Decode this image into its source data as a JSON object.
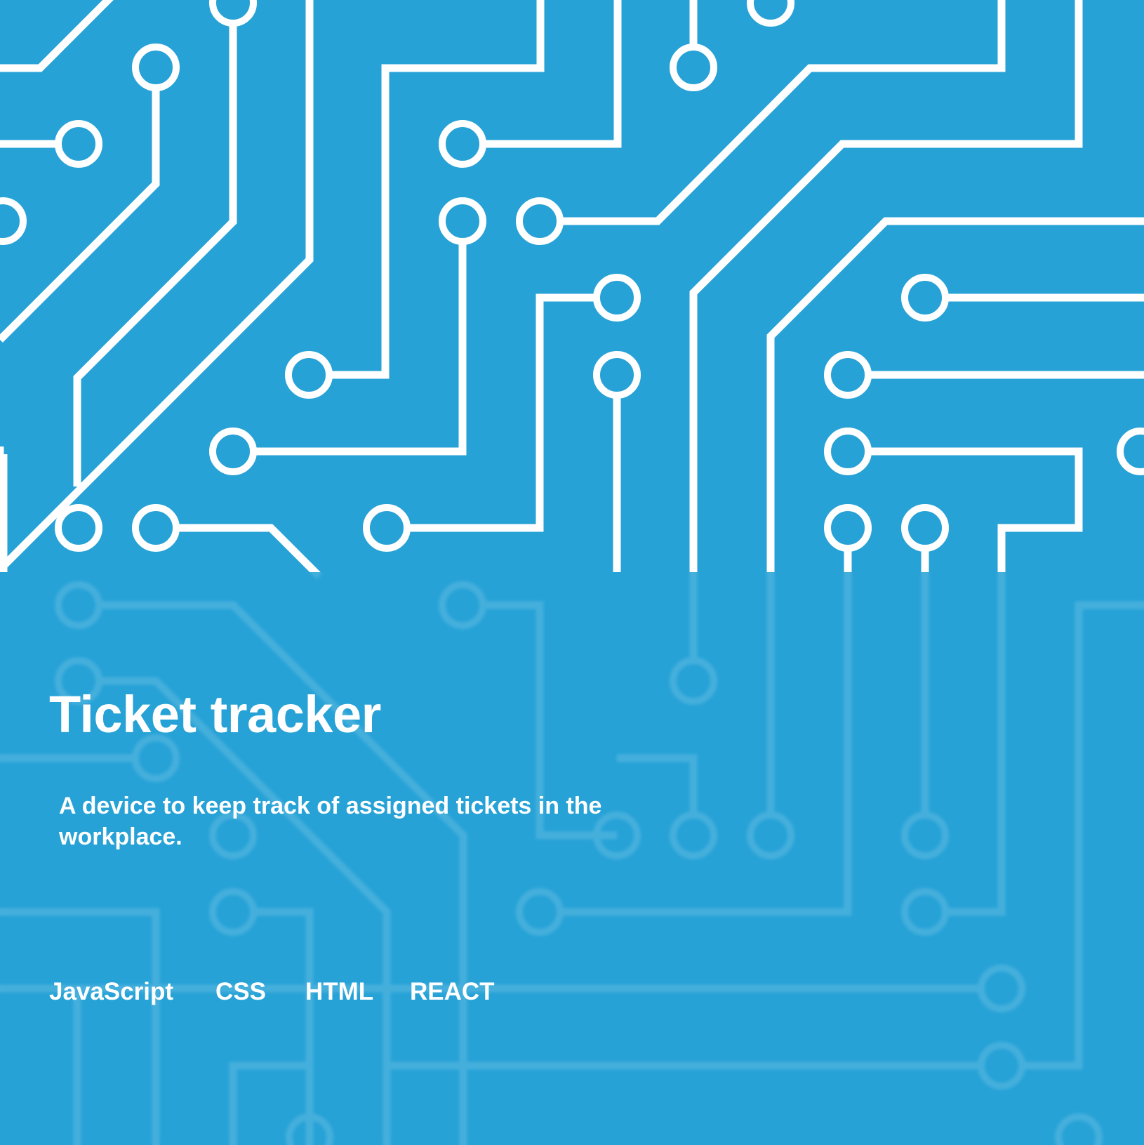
{
  "project": {
    "title": "Ticket tracker",
    "description": "A device to keep track of assigned tickets in the workplace."
  },
  "tags": [
    "JavaScript",
    "CSS",
    "HTML",
    "REACT"
  ],
  "colors": {
    "background": "#27a2d6",
    "overlay": "rgba(39,162,214,0.86)",
    "text": "#ffffff"
  },
  "decoration": "circuit-board-pattern"
}
